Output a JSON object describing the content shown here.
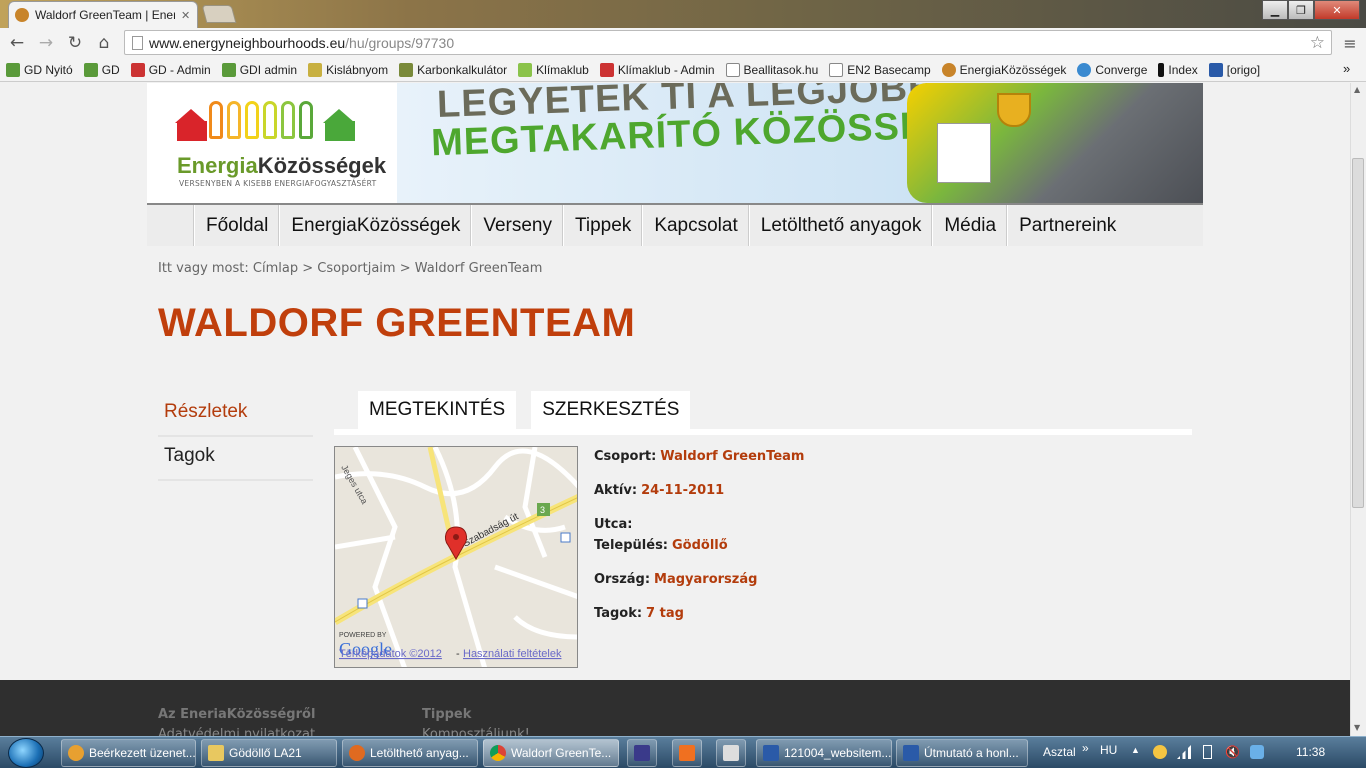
{
  "browser": {
    "tab_title": "Waldorf GreenTeam | Energ",
    "url_domain": "www.energyneighbourhoods.eu",
    "url_path": "/hu/groups/97730",
    "bookmarks": [
      "GD Nyitó",
      "GD",
      "GD - Admin",
      "GDI admin",
      "Kislábnyom",
      "Karbonkalkulátor",
      "Klímaklub",
      "Klímaklub - Admin",
      "Beallitasok.hu",
      "EN2 Basecamp",
      "EnergiaKözösségek",
      "Converge",
      "Index",
      "[origo]"
    ],
    "more_bookmarks": "»"
  },
  "site": {
    "logo_main": "Energia",
    "logo_bold": "Közösségek",
    "logo_sub": "VERSENYBEN A KISEBB ENERGIAFOGYASZTÁSÉRT",
    "slogan_line1": "LEGYETEK TI A LEGJOBB!",
    "slogan_line2": "MEGTAKARÍTÓ KÖZÖSSÉG!",
    "nav": [
      "Főoldal",
      "EnergiaKözösségek",
      "Verseny",
      "Tippek",
      "Kapcsolat",
      "Letölthető anyagok",
      "Média",
      "Partnereink"
    ]
  },
  "breadcrumb": {
    "prefix": "Itt vagy most:",
    "home": "Címlap",
    "sep1": ">",
    "groups": "Csoportjaim",
    "sep2": ">",
    "current": "Waldorf GreenTeam"
  },
  "page_title": "WALDORF GREENTEAM",
  "sidebar": {
    "items": [
      "Részletek",
      "Tagok"
    ]
  },
  "tabs": [
    "MEGTEKINTÉS",
    "SZERKESZTÉS"
  ],
  "map": {
    "road_label_1": "Szabadság út",
    "road_label_2": "Jeges utca",
    "road_number": "3",
    "powered_by": "POWERED BY",
    "google": "Google",
    "terkepadatok": "Térképadatok ©2012",
    "dash": "-",
    "terms": "Használati feltételek"
  },
  "details": {
    "csoport_label": "Csoport:",
    "csoport_value": "Waldorf GreenTeam",
    "aktiv_label": "Aktív:",
    "aktiv_value": "24-11-2011",
    "utca_label": "Utca:",
    "utca_value": "",
    "telepules_label": "Település:",
    "telepules_value": "Gödöllő",
    "orszag_label": "Ország:",
    "orszag_value": "Magyarország",
    "tagok_label": "Tagok:",
    "tagok_value": "7 tag"
  },
  "footer": {
    "col1_heading": "Az EneriaKözösségről",
    "col1_link": "Adatvédelmi nyilatkozat",
    "col2_heading": "Tippek",
    "col2_link": "Komposztáljunk!"
  },
  "taskbar": {
    "items": [
      "Beérkezett üzenet...",
      "Gödöllő LA21",
      "Letölthető anyag...",
      "Waldorf GreenTe...",
      "",
      "",
      "",
      "121004_websitem...",
      "Útmutató a honl..."
    ],
    "desktop": "Asztal",
    "chevron": "»",
    "lang": "HU",
    "time": "11:38"
  },
  "colors": {
    "accent": "#c03f0c",
    "link": "#b33c0c",
    "footer_bg": "#2f2f2f"
  }
}
